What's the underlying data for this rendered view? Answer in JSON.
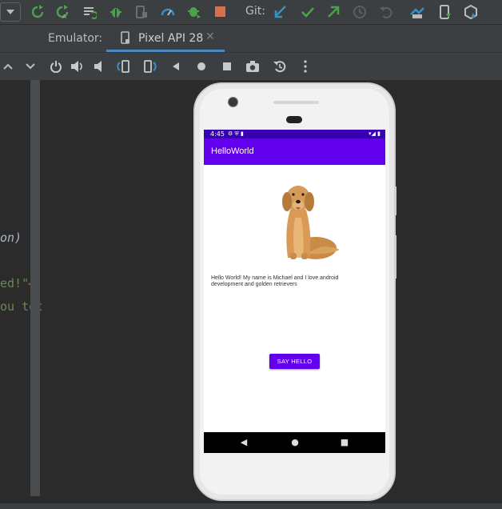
{
  "toolbar": {
    "git_label": "Git:",
    "icons": [
      "dropdown-icon",
      "sync-icon",
      "sync-all-icon",
      "apply-changes-icon",
      "debug-icon",
      "attach-icon",
      "profile-icon",
      "bug-icon",
      "stop-icon",
      "git-update-icon",
      "git-commit-icon",
      "git-push-icon",
      "history-icon",
      "revert-icon",
      "sdk-icon",
      "device-manager-icon",
      "package-icon"
    ],
    "colors": {
      "green": "#4ba24a",
      "stop": "#d6704f",
      "blue": "#3592c4",
      "gray": "#7f7f7f"
    }
  },
  "tabbar": {
    "emulator_label": "Emulator:",
    "tab_title": "Pixel API 28",
    "tab_close": "✕"
  },
  "controls": [
    "power-icon",
    "volume-up-icon",
    "volume-down-icon",
    "rotate-left-icon",
    "rotate-right-icon",
    "back-icon",
    "home-icon",
    "overview-icon",
    "screenshot-icon",
    "snapshot-icon",
    "more-icon"
  ],
  "code": {
    "line1": "on)",
    "line2_string": "ed!\"",
    "line2_arrow": "⟶",
    "line3": "ou toc"
  },
  "phone": {
    "status_time": "4:45",
    "status_icons": "⚙ ⛨ ▮",
    "status_right": "▾◢ ▮",
    "app_title": "HelloWorld",
    "message": "Hello World! My name is Michael and I love android development and golden retrievers",
    "button_label": "SAY HELLO",
    "nav_back": "◀",
    "nav_home": "●",
    "nav_recent": "■",
    "colors": {
      "statusbar": "#3700b3",
      "appbar": "#6200ee",
      "button": "#6200ee"
    }
  }
}
